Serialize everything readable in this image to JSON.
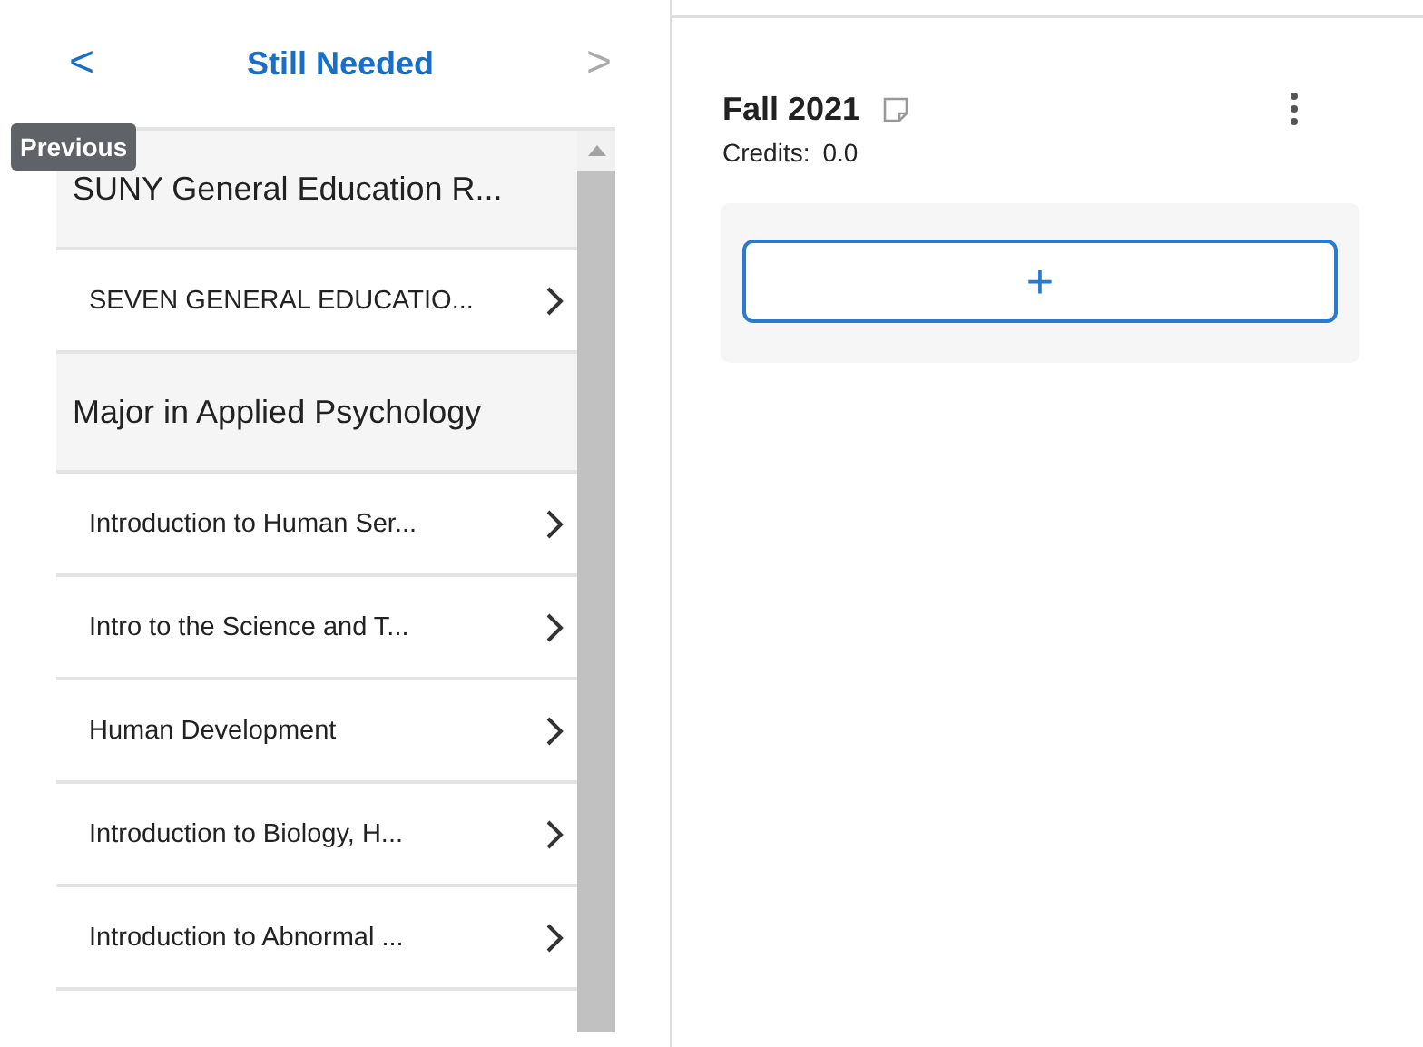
{
  "nav": {
    "previous": "<",
    "title": "Still Needed",
    "next": ">",
    "tooltip": "Previous"
  },
  "items": [
    {
      "kind": "group",
      "label": "SUNY General Education R..."
    },
    {
      "kind": "course",
      "label": "SEVEN GENERAL EDUCATIO..."
    },
    {
      "kind": "group",
      "label": "Major in Applied Psychology"
    },
    {
      "kind": "course",
      "label": "Introduction to Human Ser..."
    },
    {
      "kind": "course",
      "label": "Intro to the Science and T..."
    },
    {
      "kind": "course",
      "label": "Human Development"
    },
    {
      "kind": "course",
      "label": "Introduction to Biology, H..."
    },
    {
      "kind": "course",
      "label": "Introduction to Abnormal ..."
    }
  ],
  "term": {
    "title": "Fall 2021",
    "credits_label": "Credits:",
    "credits": "0.0",
    "add": "+"
  }
}
